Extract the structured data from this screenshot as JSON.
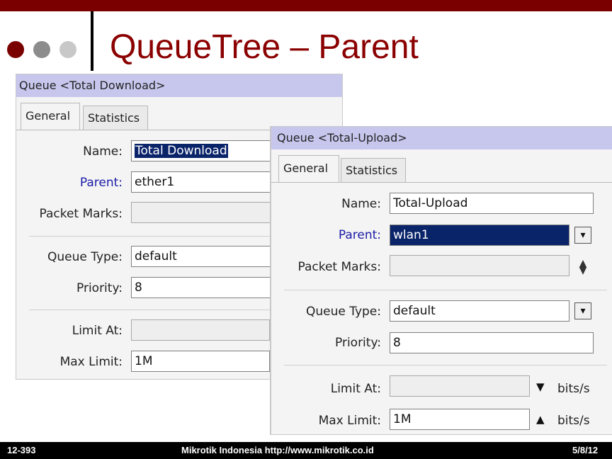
{
  "slide": {
    "title": "QueueTree – Parent",
    "colors": {
      "accent": "#8b0000",
      "topbar": "#7a0000",
      "titlebar": "#c7c7ee"
    },
    "footer": {
      "left": "12-393",
      "center": "Mikrotik Indonesia http://www.mikrotik.co.id",
      "right": "5/8/12"
    }
  },
  "window_download": {
    "title": "Queue <Total Download>",
    "tabs": [
      "General",
      "Statistics"
    ],
    "labels": {
      "name": "Name:",
      "parent": "Parent:",
      "packet_marks": "Packet Marks:",
      "queue_type": "Queue Type:",
      "priority": "Priority:",
      "limit_at": "Limit At:",
      "max_limit": "Max Limit:"
    },
    "values": {
      "name": "Total Download",
      "parent": "ether1",
      "packet_marks": "",
      "queue_type": "default",
      "priority": "8",
      "limit_at": "",
      "max_limit": "1M"
    }
  },
  "window_upload": {
    "title": "Queue <Total-Upload>",
    "tabs": [
      "General",
      "Statistics"
    ],
    "labels": {
      "name": "Name:",
      "parent": "Parent:",
      "packet_marks": "Packet Marks:",
      "queue_type": "Queue Type:",
      "priority": "Priority:",
      "limit_at": "Limit At:",
      "max_limit": "Max Limit:"
    },
    "values": {
      "name": "Total-Upload",
      "parent": "wlan1",
      "packet_marks": "",
      "queue_type": "default",
      "priority": "8",
      "limit_at": "",
      "max_limit": "1M"
    },
    "units": {
      "limit_at": "bits/s",
      "max_limit": "bits/s"
    }
  }
}
